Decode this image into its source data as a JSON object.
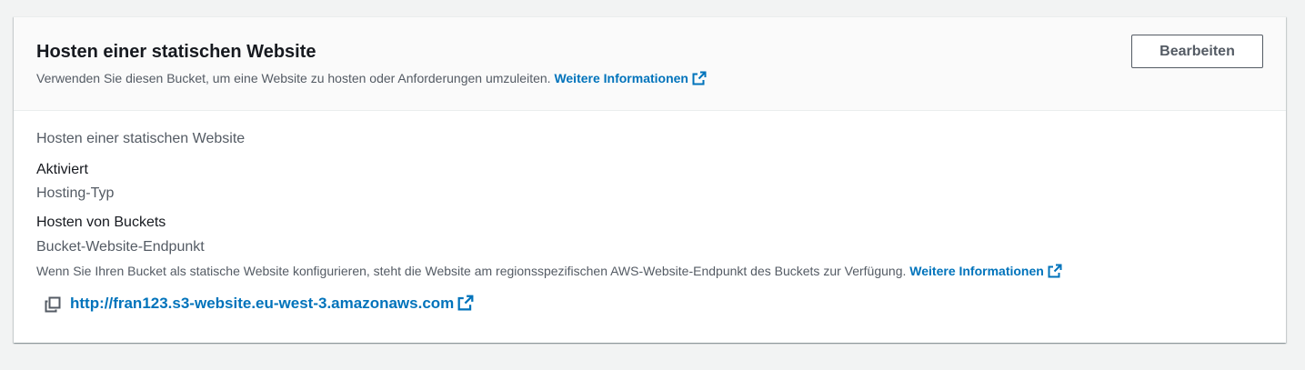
{
  "header": {
    "title": "Hosten einer statischen Website",
    "description": "Verwenden Sie diesen Bucket, um eine Website zu hosten oder Anforderungen umzuleiten.",
    "more_info_label": "Weitere Informationen",
    "edit_button_label": "Bearbeiten"
  },
  "body": {
    "section_label": "Hosten einer statischen Website",
    "status_value": "Aktiviert",
    "hosting_type_label": "Hosting-Typ",
    "hosting_type_value": "Hosten von Buckets",
    "endpoint_label": "Bucket-Website-Endpunkt",
    "endpoint_description": "Wenn Sie Ihren Bucket als statische Website konfigurieren, steht die Website am regionsspezifischen AWS-Website-Endpunkt des Buckets zur Verfügung.",
    "endpoint_more_info_label": "Weitere Informationen",
    "endpoint_url": "http://fran123.s3-website.eu-west-3.amazonaws.com"
  },
  "icons": {
    "external_link": "external-link-icon",
    "copy": "copy-icon"
  },
  "colors": {
    "link": "#0073bb",
    "text": "#16191f",
    "secondary_text": "#545b64",
    "background": "#f2f3f3"
  }
}
